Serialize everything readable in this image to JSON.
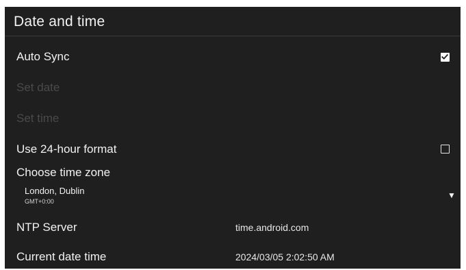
{
  "title": "Date and time",
  "auto_sync": {
    "label": "Auto Sync",
    "checked": true
  },
  "set_date": {
    "label": "Set date",
    "enabled": false
  },
  "set_time": {
    "label": "Set time",
    "enabled": false
  },
  "use_24_hour": {
    "label": "Use 24-hour format",
    "checked": false
  },
  "time_zone": {
    "label": "Choose time zone",
    "selected_city": "London, Dublin",
    "selected_offset": "GMT+0:00",
    "dropdown_icon": "triangle-down-icon"
  },
  "ntp_server": {
    "label": "NTP Server",
    "value": "time.android.com"
  },
  "current_date_time": {
    "label": "Current date time",
    "value": "2024/03/05 2:02:50 AM"
  },
  "colors": {
    "panel_background": "#1f1f1f",
    "text_primary": "#f2f2f2",
    "text_disabled": "#4a4a4a"
  }
}
